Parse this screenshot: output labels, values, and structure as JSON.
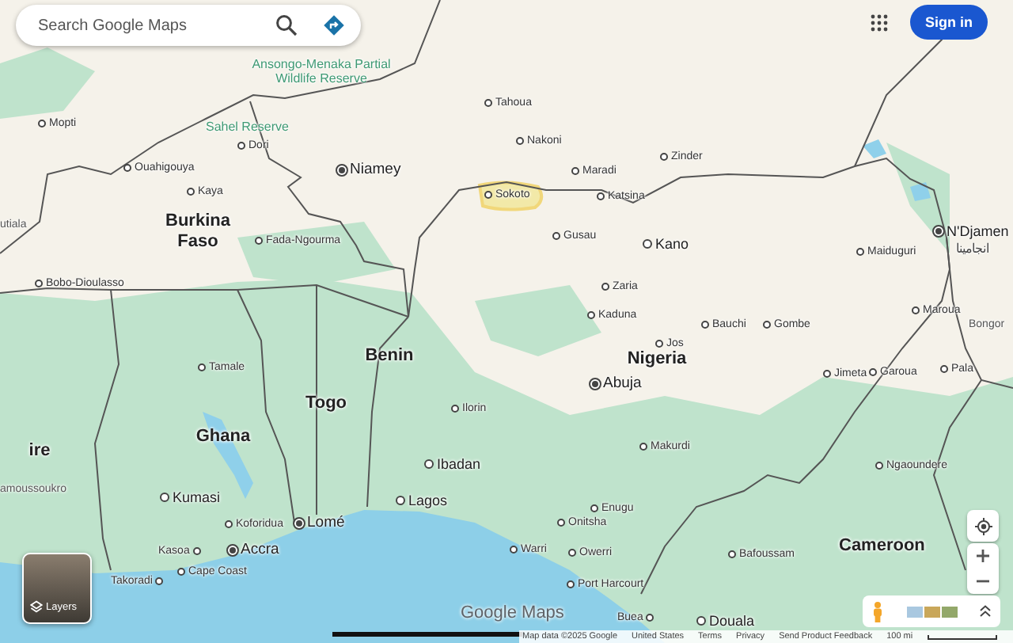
{
  "search": {
    "placeholder": "Search Google Maps"
  },
  "account": {
    "button": "Sign in"
  },
  "places": [
    {
      "name": "Mopti",
      "kind": "town"
    },
    {
      "name": "Ansongo-Menaka Partial Wildlife Reserve",
      "kind": "reserve"
    },
    {
      "name": "Sahel Reserve",
      "kind": "reserve"
    },
    {
      "name": "Tahoua",
      "kind": "town"
    },
    {
      "name": "Dori",
      "kind": "town"
    },
    {
      "name": "Niamey",
      "kind": "capital"
    },
    {
      "name": "Nakoni",
      "kind": "town"
    },
    {
      "name": "Maradi",
      "kind": "town"
    },
    {
      "name": "Zinder",
      "kind": "town"
    },
    {
      "name": "Ouahigouya",
      "kind": "town"
    },
    {
      "name": "Kaya",
      "kind": "town"
    },
    {
      "name": "utiala",
      "kind": "fragment"
    },
    {
      "name": "Burkina Faso",
      "kind": "country"
    },
    {
      "name": "Sokoto",
      "kind": "highlighted"
    },
    {
      "name": "Katsina",
      "kind": "town"
    },
    {
      "name": "Fada-Ngourma",
      "kind": "town"
    },
    {
      "name": "Gusau",
      "kind": "town"
    },
    {
      "name": "Kano",
      "kind": "city"
    },
    {
      "name": "Maiduguri",
      "kind": "town"
    },
    {
      "name": "N'Djamen",
      "kind": "capital"
    },
    {
      "name": "انجامينا",
      "kind": "subtitle"
    },
    {
      "name": "Bobo-Dioulasso",
      "kind": "town"
    },
    {
      "name": "Zaria",
      "kind": "town"
    },
    {
      "name": "Kaduna",
      "kind": "town"
    },
    {
      "name": "Bauchi",
      "kind": "town"
    },
    {
      "name": "Gombe",
      "kind": "town"
    },
    {
      "name": "Maroua",
      "kind": "town"
    },
    {
      "name": "Bongor",
      "kind": "fragment"
    },
    {
      "name": "Jos",
      "kind": "town"
    },
    {
      "name": "Tamale",
      "kind": "town"
    },
    {
      "name": "Benin",
      "kind": "country"
    },
    {
      "name": "Nigeria",
      "kind": "country"
    },
    {
      "name": "Abuja",
      "kind": "capital"
    },
    {
      "name": "Jimeta",
      "kind": "town"
    },
    {
      "name": "Garoua",
      "kind": "town"
    },
    {
      "name": "Pala",
      "kind": "town"
    },
    {
      "name": "Togo",
      "kind": "country"
    },
    {
      "name": "Ilorin",
      "kind": "town"
    },
    {
      "name": "Ghana",
      "kind": "country"
    },
    {
      "name": "ire",
      "kind": "country"
    },
    {
      "name": "Ibadan",
      "kind": "city"
    },
    {
      "name": "Makurdi",
      "kind": "town"
    },
    {
      "name": "Ngaoundere",
      "kind": "town"
    },
    {
      "name": "amoussoukro",
      "kind": "fragment"
    },
    {
      "name": "Kumasi",
      "kind": "city"
    },
    {
      "name": "Lagos",
      "kind": "city"
    },
    {
      "name": "Enugu",
      "kind": "town"
    },
    {
      "name": "Koforidua",
      "kind": "town"
    },
    {
      "name": "Lomé",
      "kind": "capital"
    },
    {
      "name": "Onitsha",
      "kind": "town"
    },
    {
      "name": "Kasoa",
      "kind": "town-left"
    },
    {
      "name": "Accra",
      "kind": "capital"
    },
    {
      "name": "Warri",
      "kind": "town"
    },
    {
      "name": "Owerri",
      "kind": "town"
    },
    {
      "name": "Bafoussam",
      "kind": "town"
    },
    {
      "name": "Cameroon",
      "kind": "country"
    },
    {
      "name": "Takoradi",
      "kind": "town-left"
    },
    {
      "name": "Cape Coast",
      "kind": "town"
    },
    {
      "name": "Port Harcourt",
      "kind": "town"
    },
    {
      "name": "Buea",
      "kind": "town-left"
    },
    {
      "name": "Douala",
      "kind": "city"
    }
  ],
  "layers": {
    "label": "Layers"
  },
  "logo": "Google Maps",
  "footer": {
    "attribution": "Map data ©2025 Google",
    "links": [
      "United States",
      "Terms",
      "Privacy",
      "Send Product Feedback"
    ],
    "scale": "100 mi"
  }
}
